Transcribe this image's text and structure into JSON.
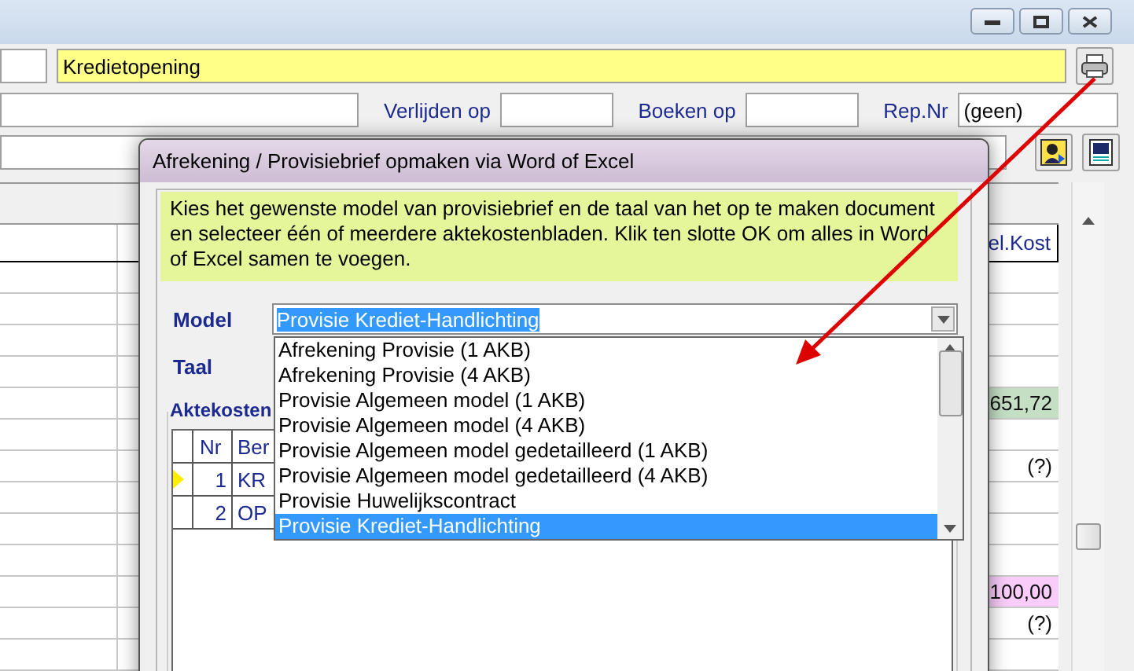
{
  "header": {
    "document_type": "Kredietopening"
  },
  "fields": [
    {
      "label": "Verlijden op"
    },
    {
      "label": "Boeken op"
    },
    {
      "label": "Rep.Nr",
      "value": "(geen)"
    }
  ],
  "grid": {
    "column_header": "el.Kost",
    "rows": [
      {
        "kind": "empty"
      },
      {
        "kind": "empty"
      },
      {
        "kind": "empty"
      },
      {
        "kind": "empty"
      },
      {
        "kind": "amount",
        "value": "651,72",
        "color": "#c5dfc5"
      },
      {
        "kind": "empty"
      },
      {
        "kind": "amount",
        "value": "(?)",
        "color": "#ffffff"
      },
      {
        "kind": "empty"
      },
      {
        "kind": "empty"
      },
      {
        "kind": "empty"
      },
      {
        "kind": "amount",
        "value": "100,00",
        "color": "#f9ccf9"
      },
      {
        "kind": "amount",
        "value": "(?)",
        "color": "#ffffff"
      },
      {
        "kind": "empty"
      }
    ]
  },
  "dialog": {
    "title": "Afrekening / Provisiebrief opmaken via Word of Excel",
    "info": "Kies het gewenste model van provisiebrief en de taal van het op te maken document en selecteer één of meerdere aktekostenbladen. Klik ten slotte OK om alles in Word of Excel samen te voegen.",
    "model_label": "Model",
    "model_value": "Provisie Krediet-Handlichting",
    "taal_label": "Taal",
    "model_options": [
      {
        "label": "Afrekening Provisie (1 AKB)",
        "selected": false
      },
      {
        "label": "Afrekening Provisie (4 AKB)",
        "selected": false
      },
      {
        "label": "Provisie Algemeen model (1 AKB)",
        "selected": false
      },
      {
        "label": "Provisie Algemeen model (4 AKB)",
        "selected": false
      },
      {
        "label": "Provisie Algemeen model gedetailleerd (1 AKB)",
        "selected": false
      },
      {
        "label": "Provisie Algemeen model gedetailleerd (4 AKB)",
        "selected": false
      },
      {
        "label": "Provisie Huwelijkscontract",
        "selected": false
      },
      {
        "label": "Provisie Krediet-Handlichting",
        "selected": true
      }
    ],
    "group_title": "Aktekosten",
    "table": {
      "columns": [
        "Nr",
        "Ber"
      ],
      "rows": [
        {
          "current": true,
          "nr": "1",
          "code": "KR"
        },
        {
          "current": false,
          "nr": "2",
          "code": "OP"
        }
      ]
    }
  }
}
